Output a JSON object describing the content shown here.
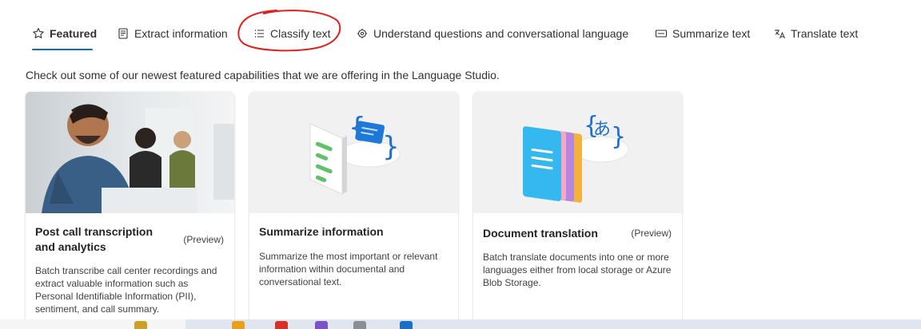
{
  "tabs": [
    {
      "label": "Featured",
      "icon": "star-icon",
      "active": true
    },
    {
      "label": "Extract information",
      "icon": "document-icon"
    },
    {
      "label": "Classify text",
      "icon": "list-icon"
    },
    {
      "label": "Understand questions and conversational language",
      "icon": "chat-gear-icon"
    },
    {
      "label": "Summarize text",
      "icon": "summary-icon"
    },
    {
      "label": "Translate text",
      "icon": "translate-icon"
    }
  ],
  "intro": "Check out some of our newest featured capabilities that we are offering in the Language Studio.",
  "cards": [
    {
      "title": "Post call transcription and analytics",
      "badge": "(Preview)",
      "description": "Batch transcribe call center recordings and extract valuable information such as Personal Identifiable Information (PII), sentiment, and call summary."
    },
    {
      "title": "Summarize information",
      "badge": "",
      "description": "Summarize the most important or relevant information within documental and conversational text."
    },
    {
      "title": "Document translation",
      "badge": "(Preview)",
      "description": "Batch translate documents into one or more languages either from local storage or Azure Blob Storage."
    }
  ],
  "colors": {
    "accent": "#0f6cbd",
    "annotation": "#e0201b"
  }
}
